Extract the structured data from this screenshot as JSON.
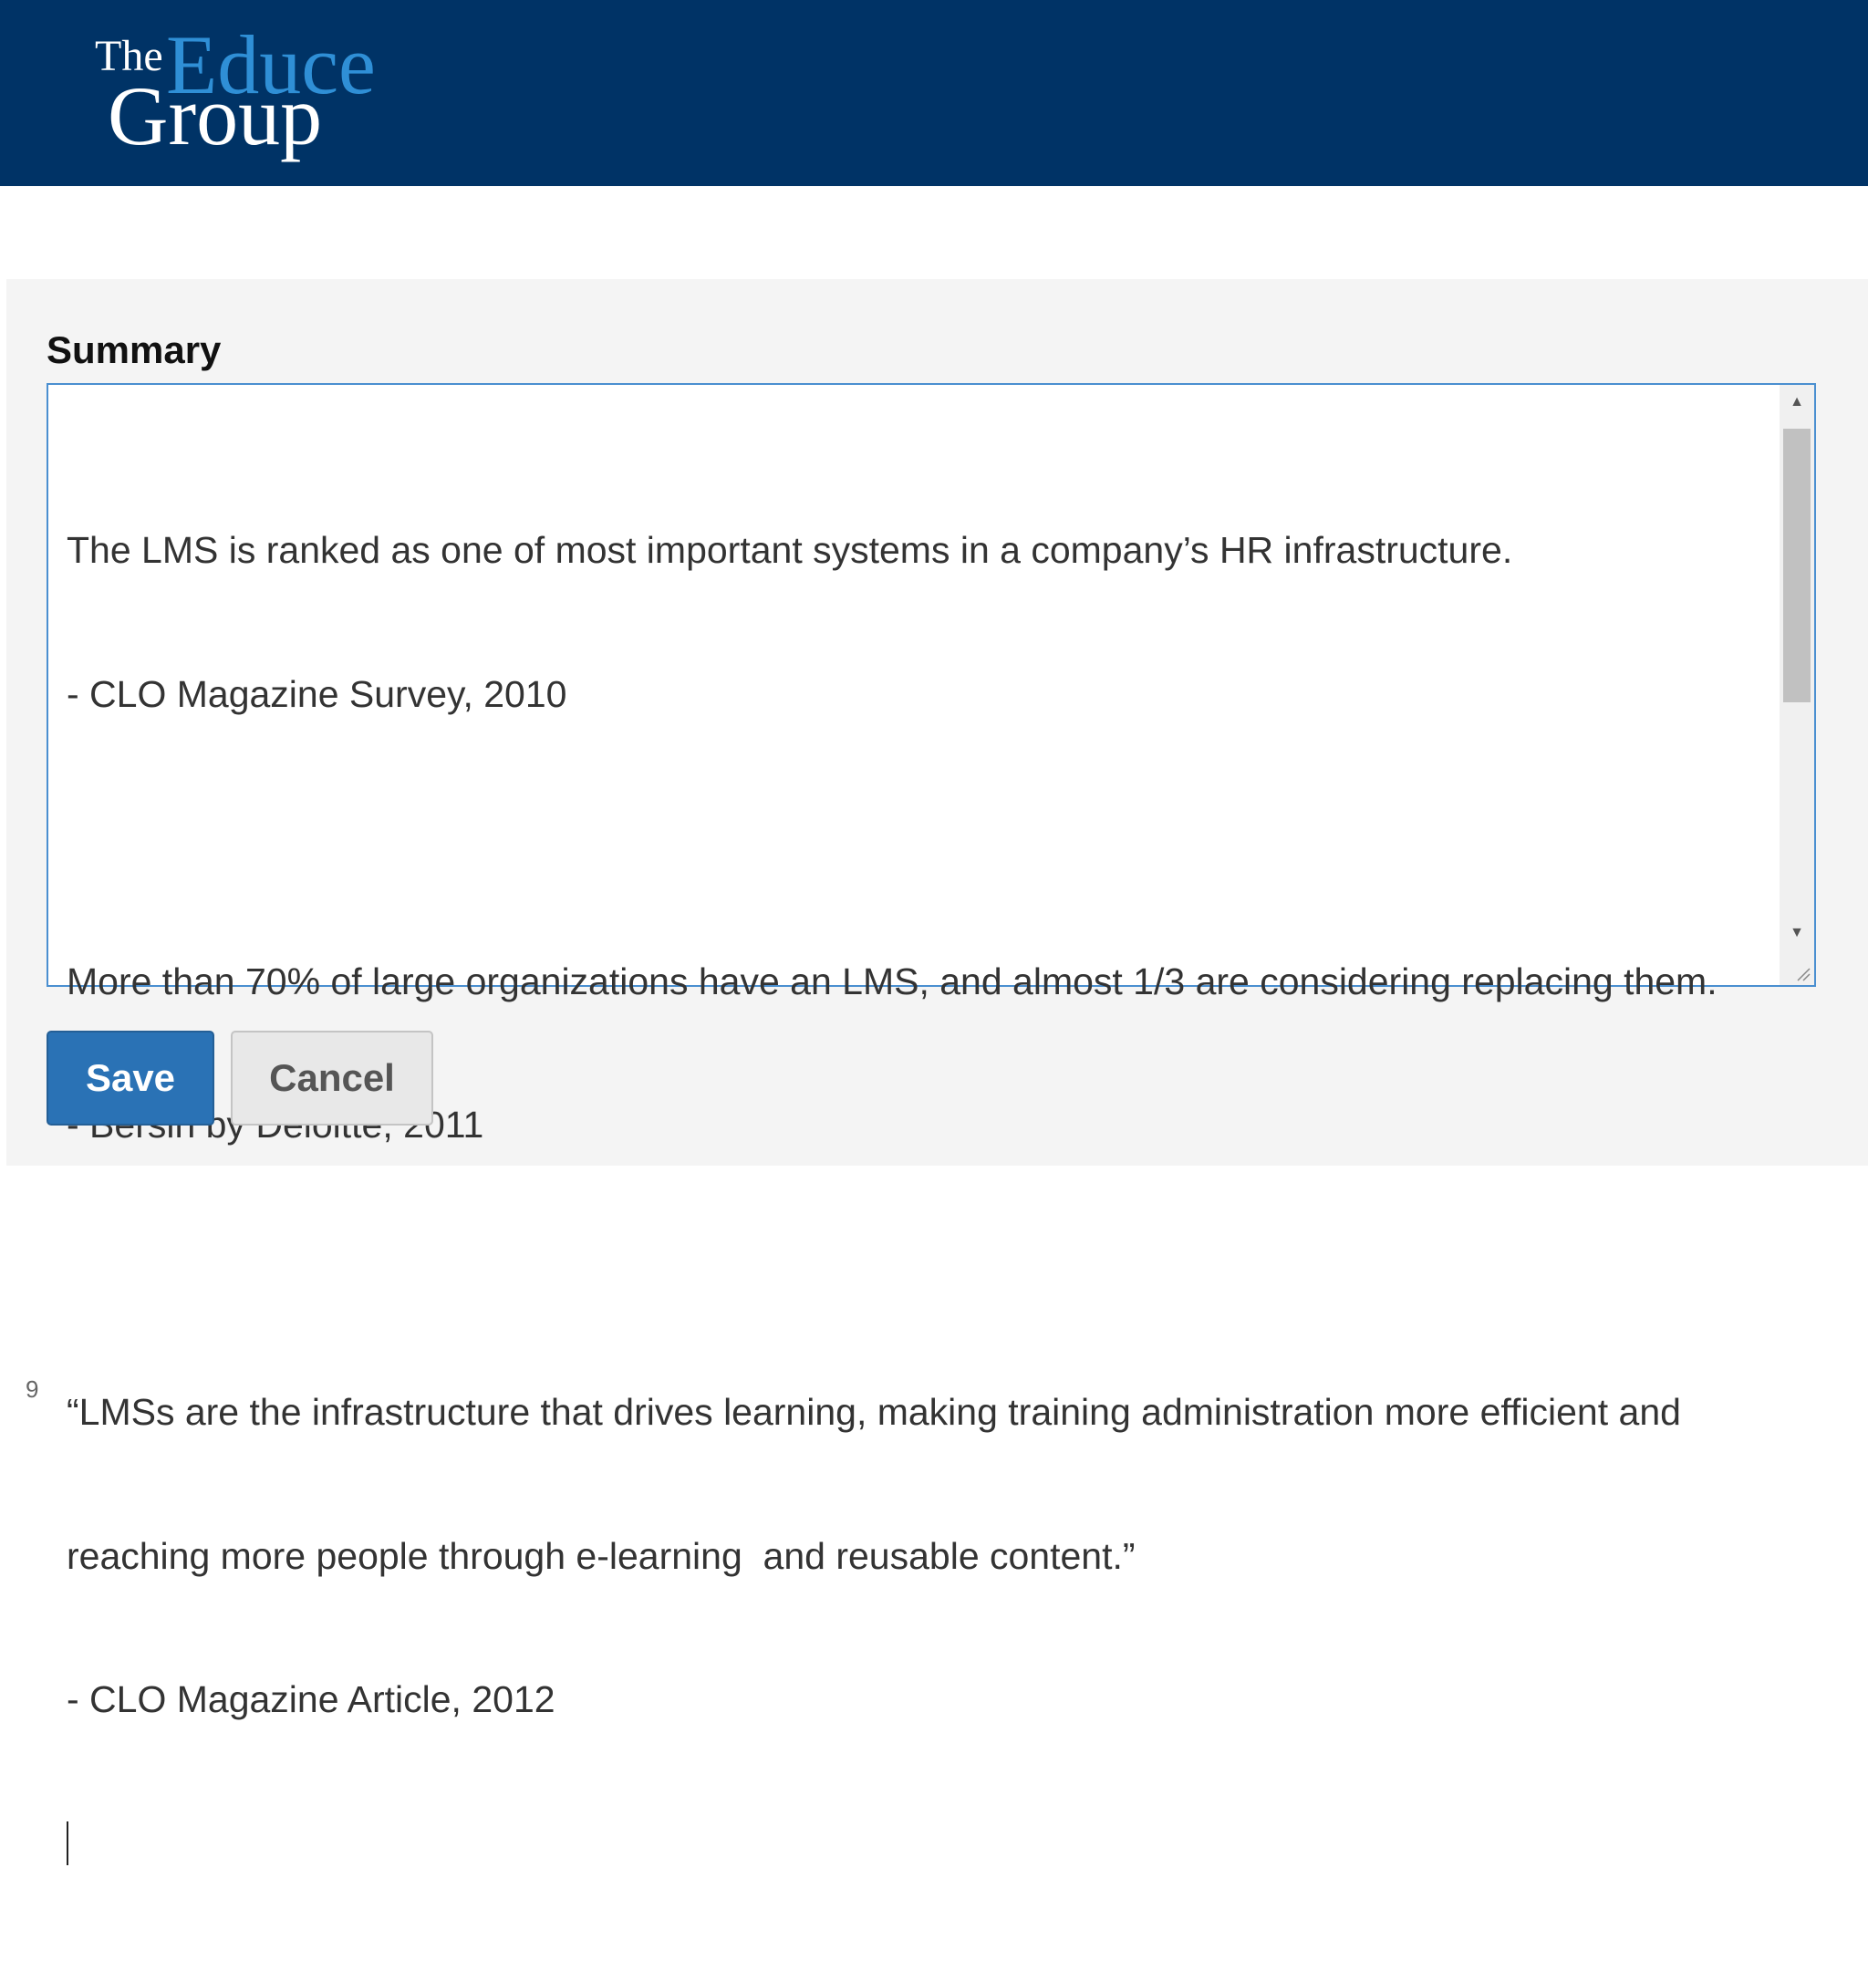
{
  "header": {
    "logo_the": "The",
    "logo_educe": "Educe",
    "logo_group": "Group"
  },
  "form": {
    "label": "Summary",
    "lines": [
      "The LMS is ranked as one of most important systems in a company’s HR infrastructure.",
      "- CLO Magazine Survey, 2010",
      "",
      "More than 70% of large organizations have an LMS, and almost 1/3 are considering replacing them.",
      "- Bersin by Deloitte, 2011",
      "",
      "“LMSs are the infrastructure that drives learning, making training administration more efficient and",
      "reaching more people through e-learning  and reusable content.”",
      "- CLO Magazine Article, 2012"
    ],
    "save_label": "Save",
    "cancel_label": "Cancel"
  },
  "page_number": "9"
}
